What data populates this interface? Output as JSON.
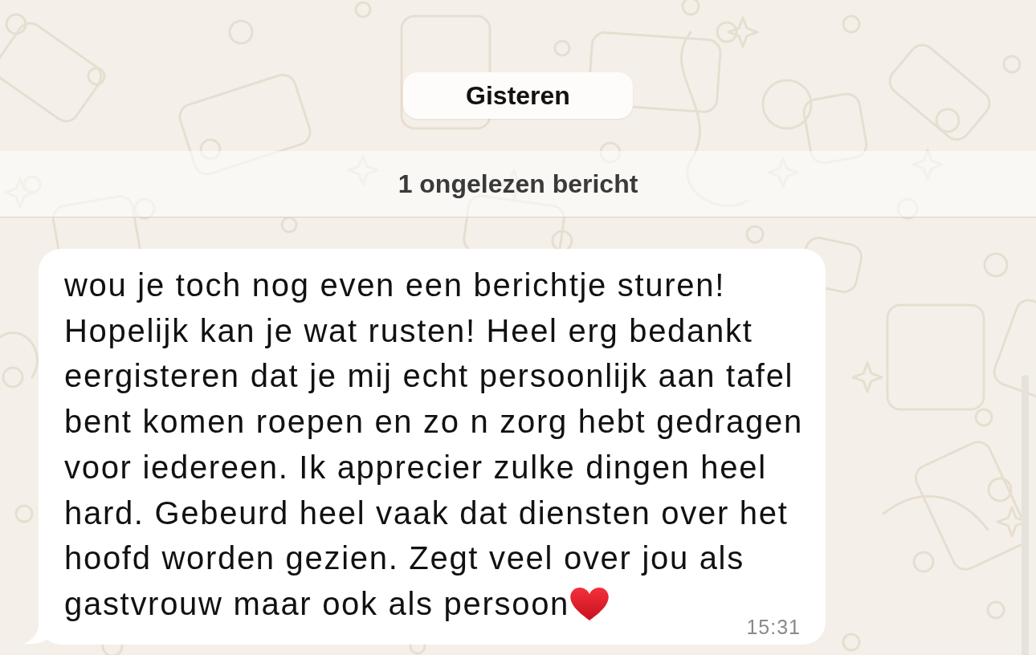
{
  "chat": {
    "date_separator": "Gisteren",
    "unread_banner": "1 ongelezen bericht",
    "messages": [
      {
        "incoming": true,
        "text": "wou je toch nog even een berichtje sturen! Hopelijk kan je wat rusten! Heel erg bedankt eergisteren dat je mij echt persoonlijk aan tafel bent komen roepen en zo n zorg hebt gedragen voor iedereen. Ik apprecier zulke dingen heel hard. Gebeurd heel vaak dat diensten over het hoofd worden gezien. Zegt veel over jou als gastvrouw maar ook als persoon",
        "time": "15:31"
      }
    ]
  }
}
